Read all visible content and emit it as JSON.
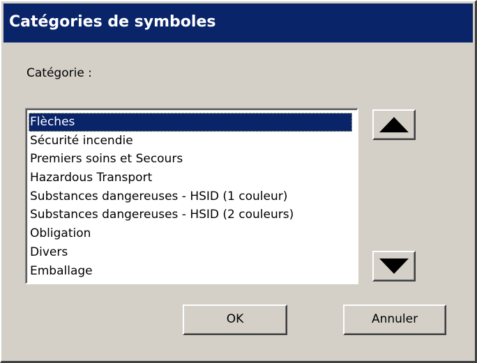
{
  "window": {
    "title": "Catégories de symboles"
  },
  "category_label": "Catégorie :",
  "category_list": {
    "items": [
      "Flèches",
      "Sécurité incendie",
      "Premiers soins et Secours",
      "Hazardous Transport",
      "Substances dangereuses - HSID (1 couleur)",
      "Substances dangereuses - HSID (2 couleurs)",
      "Obligation",
      "Divers",
      "Emballage"
    ],
    "selected_index": 0
  },
  "scroll": {
    "up_icon": "arrow-up-icon",
    "down_icon": "arrow-down-icon"
  },
  "buttons": {
    "ok_label": "OK",
    "cancel_label": "Annuler"
  },
  "colors": {
    "titlebar": "#0a246a",
    "selection": "#0a246a",
    "face": "#d4d0c8"
  }
}
